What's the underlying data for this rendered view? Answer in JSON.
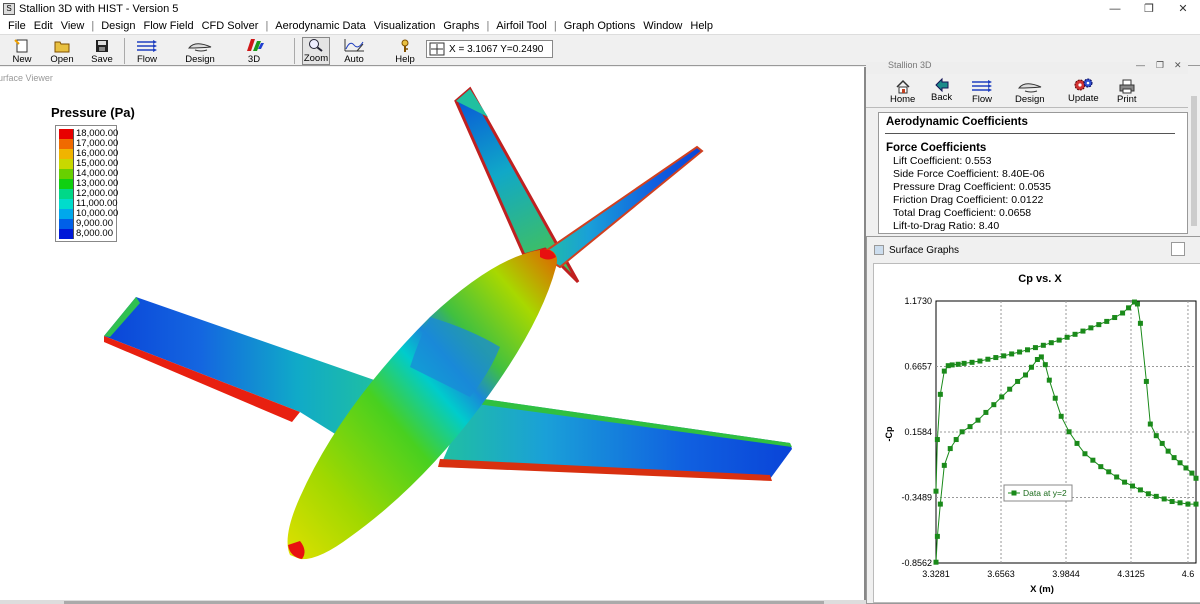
{
  "window": {
    "title": "Stallion 3D with HIST - Version 5",
    "controls": {
      "minimize": "—",
      "restore": "❐",
      "close": "✕"
    }
  },
  "menu": {
    "items": [
      "File",
      "Edit",
      "View",
      "|",
      "Design",
      "Flow Field",
      "CFD Solver",
      "|",
      "Aerodynamic Data",
      "Visualization",
      "Graphs",
      "|",
      "Airfoil Tool",
      "|",
      "Graph Options",
      "Window",
      "Help"
    ]
  },
  "toolbar": {
    "new_label": "New",
    "open_label": "Open",
    "save_label": "Save",
    "flow_label": "Flow",
    "design_label": "Design",
    "view3d_label": "3D",
    "zoom_label": "Zoom",
    "auto_label": "Auto",
    "help_label": "Help",
    "coord_readout": "X = 3.1067  Y=0.2490"
  },
  "viewer": {
    "title": "Surface Viewer",
    "legend": {
      "title": "Pressure (Pa)",
      "entries": [
        {
          "label": "18,000.00",
          "color": "#e80000"
        },
        {
          "label": "17,000.00",
          "color": "#f06a00"
        },
        {
          "label": "16,000.00",
          "color": "#f0b400"
        },
        {
          "label": "15,000.00",
          "color": "#c8d800"
        },
        {
          "label": "14,000.00",
          "color": "#68d000"
        },
        {
          "label": "13,000.00",
          "color": "#10d010"
        },
        {
          "label": "12,000.00",
          "color": "#00d888"
        },
        {
          "label": "11,000.00",
          "color": "#00dccc"
        },
        {
          "label": "10,000.00",
          "color": "#00a8ec"
        },
        {
          "label": "9,000.00",
          "color": "#0060e8"
        },
        {
          "label": "8,000.00",
          "color": "#0018d8"
        }
      ]
    }
  },
  "stallion_panel": {
    "title": "Stallion 3D",
    "buttons": {
      "home": "Home",
      "back": "Back",
      "flow": "Flow",
      "design": "Design",
      "update": "Update",
      "print": "Print"
    }
  },
  "coefficients": {
    "heading": "Aerodynamic Coefficients",
    "section": "Force Coefficients",
    "lines": [
      "Lift Coefficient: 0.553",
      "Side Force Coefficient: 8.40E-06",
      "Pressure Drag Coefficient: 0.0535",
      "Friction Drag Coefficient: 0.0122",
      "Total Drag Coefficient: 0.0658",
      "Lift-to-Drag Ratio: 8.40"
    ]
  },
  "surface_graphs": {
    "window_title": "Surface Graphs"
  },
  "chart_data": {
    "type": "line",
    "title": "Cp vs. X",
    "xlabel": "X (m)",
    "ylabel": "-Cp",
    "xlim": [
      3.3281,
      4.6406
    ],
    "ylim": [
      -0.8562,
      1.173
    ],
    "xticks": [
      "3.3281",
      "3.6563",
      "3.9844",
      "4.3125",
      "4.6"
    ],
    "yticks": [
      "1.1730",
      "0.6657",
      "0.1584",
      "-0.3489",
      "-0.8562"
    ],
    "grid": true,
    "legend_position": "center-left",
    "color": "#1a8a1a",
    "series": [
      {
        "name": "Data at y=2",
        "x": [
          3.3281,
          3.335,
          3.35,
          3.37,
          3.39,
          3.41,
          3.44,
          3.47,
          3.51,
          3.55,
          3.59,
          3.63,
          3.67,
          3.71,
          3.75,
          3.79,
          3.83,
          3.87,
          3.91,
          3.95,
          3.99,
          4.03,
          4.07,
          4.11,
          4.15,
          4.19,
          4.23,
          4.27,
          4.3,
          4.33,
          4.345,
          4.36,
          4.39,
          4.41,
          4.44,
          4.47,
          4.5,
          4.53,
          4.56,
          4.59,
          4.62,
          4.6406
        ],
        "y": [
          -0.3,
          0.1,
          0.45,
          0.63,
          0.672,
          0.678,
          0.683,
          0.69,
          0.698,
          0.708,
          0.722,
          0.735,
          0.748,
          0.763,
          0.778,
          0.795,
          0.812,
          0.83,
          0.85,
          0.87,
          0.892,
          0.915,
          0.94,
          0.965,
          0.99,
          1.015,
          1.045,
          1.08,
          1.12,
          1.165,
          1.15,
          1.0,
          0.55,
          0.22,
          0.13,
          0.07,
          0.01,
          -0.04,
          -0.08,
          -0.12,
          -0.16,
          -0.2
        ]
      },
      {
        "name": "",
        "x": [
          3.3281,
          3.335,
          3.35,
          3.37,
          3.4,
          3.43,
          3.46,
          3.5,
          3.54,
          3.58,
          3.62,
          3.66,
          3.7,
          3.74,
          3.78,
          3.81,
          3.84,
          3.86,
          3.88,
          3.9,
          3.93,
          3.96,
          4.0,
          4.04,
          4.08,
          4.12,
          4.16,
          4.2,
          4.24,
          4.28,
          4.32,
          4.36,
          4.4,
          4.44,
          4.48,
          4.52,
          4.56,
          4.6,
          4.6406
        ],
        "y": [
          -0.85,
          -0.65,
          -0.4,
          -0.1,
          0.03,
          0.1,
          0.16,
          0.2,
          0.25,
          0.31,
          0.37,
          0.43,
          0.49,
          0.55,
          0.6,
          0.66,
          0.72,
          0.74,
          0.68,
          0.56,
          0.42,
          0.28,
          0.16,
          0.07,
          -0.01,
          -0.06,
          -0.11,
          -0.15,
          -0.19,
          -0.23,
          -0.26,
          -0.29,
          -0.32,
          -0.34,
          -0.36,
          -0.38,
          -0.39,
          -0.4,
          -0.4
        ]
      }
    ]
  }
}
